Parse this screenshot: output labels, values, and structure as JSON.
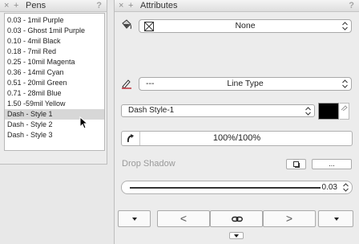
{
  "pens": {
    "title": "Pens",
    "close": "×",
    "add": "+",
    "help": "?",
    "items": [
      "0.03 - 1mil Purple",
      "0.03 - Ghost 1mil Purple",
      "0.10 - 4mil Black",
      "0.18 - 7mil Red",
      "0.25 - 10mil Magenta",
      "0.36 - 14mil Cyan",
      "0.51 - 20mil Green",
      "0.71 - 28mil Blue",
      "1.50 -59mil Yellow",
      "Dash - Style 1",
      "Dash - Style 2",
      "Dash - Style 3"
    ],
    "selected_index": 9
  },
  "attributes": {
    "title": "Attributes",
    "close": "×",
    "add": "+",
    "help": "?",
    "fill_value": "None",
    "line_value": "---",
    "line_type_label": "Line Type",
    "dash_style_value": "Dash Style-1",
    "stroke_color": "#000000",
    "opacity_value": "100%/100%",
    "drop_shadow_label": "Drop Shadow",
    "shadow_options_label": "...",
    "line_weight_value": "0.03",
    "prev_label": "<",
    "next_label": ">"
  }
}
